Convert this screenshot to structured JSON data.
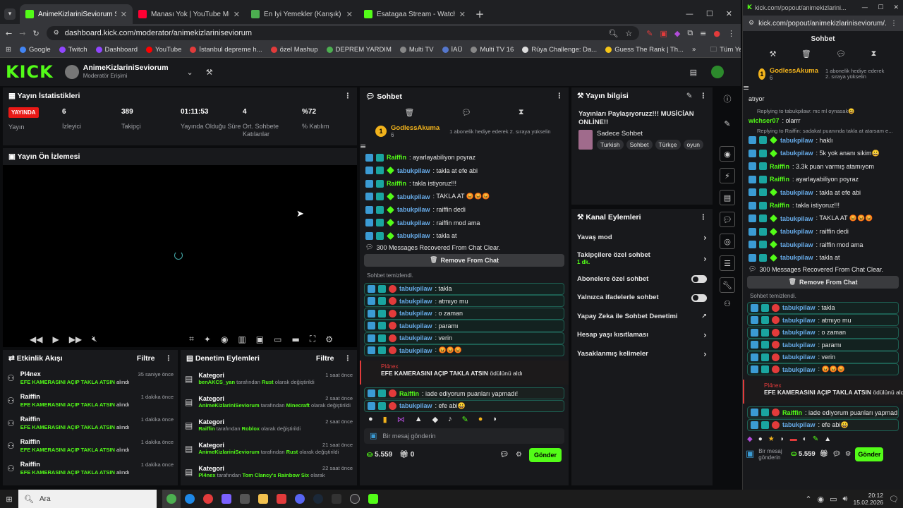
{
  "tabs": [
    {
      "title": "AnimeKizlariniSeviorum Stream",
      "color": "#53fc18",
      "active": true
    },
    {
      "title": "Manası Yok | YouTube Music",
      "color": "#ff0033",
      "active": false
    },
    {
      "title": "En İyi Yemekler (Karışık) - Tier List",
      "color": "#4caf50",
      "active": false
    },
    {
      "title": "Esatagaa Stream - Watch Live on Kick",
      "color": "#53fc18",
      "active": false
    }
  ],
  "address": {
    "url": "dashboard.kick.com/moderator/animekizlariniseviorum"
  },
  "bookmarks": [
    {
      "label": "Google",
      "color": "#4285f4"
    },
    {
      "label": "Twitch",
      "color": "#9146ff"
    },
    {
      "label": "Dashboard",
      "color": "#9146ff"
    },
    {
      "label": "YouTube",
      "color": "#ff0000"
    },
    {
      "label": "İstanbul depreme h...",
      "color": "#e23b3b"
    },
    {
      "label": "özel Mashup",
      "color": "#e23b3b"
    },
    {
      "label": "DEPREM YARDIM",
      "color": "#4caf50"
    },
    {
      "label": "Multi TV",
      "color": "#888"
    },
    {
      "label": "İAÜ",
      "color": "#5577cc"
    },
    {
      "label": "Multi TV 16",
      "color": "#888"
    },
    {
      "label": "Rüya Challenge: Da...",
      "color": "#ddd"
    },
    {
      "label": "Guess The Rank | Th...",
      "color": "#f5c518"
    }
  ],
  "bookmarks_all": "Tüm Yer İşaretleri",
  "header": {
    "logo": "KICK",
    "channel": "AnimeKizlariniSeviorum",
    "role": "Moderatör Erişimi"
  },
  "stats": {
    "title": "Yayın İstatistikleri",
    "live": "YAYINDA",
    "live_label": "Yayın",
    "items": [
      {
        "value": "6",
        "label": "İzleyici"
      },
      {
        "value": "389",
        "label": "Takipçi"
      },
      {
        "value": "01:11:53",
        "label": "Yayında Olduğu Süre"
      },
      {
        "value": "4",
        "label": "Ort. Sohbete Katılanlar"
      },
      {
        "value": "%72",
        "label": "% Katılım"
      }
    ]
  },
  "preview": {
    "title": "Yayın Ön İzlemesi"
  },
  "activity": {
    "title": "Etkinlik Akışı",
    "filter": "Filtre",
    "items": [
      {
        "user": "Pl4nex",
        "action": "EFE KAMERASINI AÇIP TAKLA ATSIN",
        "suffix": "alındı",
        "time": "35 saniye önce"
      },
      {
        "user": "Raiffin",
        "action": "EFE KAMERASINI AÇIP TAKLA ATSIN",
        "suffix": "alındı",
        "time": "1 dakika önce"
      },
      {
        "user": "Raiffin",
        "action": "EFE KAMERASINI AÇIP TAKLA ATSIN",
        "suffix": "alındı",
        "time": "1 dakika önce"
      },
      {
        "user": "Raiffin",
        "action": "EFE KAMERASINI AÇIP TAKLA ATSIN",
        "suffix": "alındı",
        "time": "1 dakika önce"
      },
      {
        "user": "Raiffin",
        "action": "EFE KAMERASINI AÇIP TAKLA ATSIN",
        "suffix": "alındı",
        "time": "1 dakika önce"
      }
    ]
  },
  "audit": {
    "title": "Denetim Eylemleri",
    "filter": "Filtre",
    "items": [
      {
        "title": "Kategori",
        "user": "benAKCS_yan",
        "mid": "tarafından",
        "target": "Rust",
        "tail": "olarak değiştirildi",
        "time": "1 saat önce"
      },
      {
        "title": "Kategori",
        "user": "AnimeKizlariniSeviorum",
        "mid": "tarafından",
        "target": "Minecraft",
        "tail": "olarak değiştirildi",
        "time": "2 saat önce"
      },
      {
        "title": "Kategori",
        "user": "Raiffin",
        "mid": "tarafından",
        "target": "Roblox",
        "tail": "olarak değiştirildi",
        "time": "2 saat önce"
      },
      {
        "title": "Kategori",
        "user": "AnimeKizlariniSeviorum",
        "mid": "tarafından",
        "target": "Rust",
        "tail": "olarak değiştirildi",
        "time": "21 saat önce"
      },
      {
        "title": "Kategori",
        "user": "Pl4nex",
        "mid": "tarafından",
        "target": "Tom Clancy's Rainbow Six",
        "tail": "olarak",
        "time": "22 saat önce"
      }
    ]
  },
  "chat": {
    "title": "Sohbet",
    "pinned_user": "GodlessAkuma",
    "pinned_count": "6",
    "pinned_note": "1 abonelik hediye ederek 2. sıraya yükselin",
    "messages": [
      {
        "user": "Raiffin",
        "text": ": ayarlayabiliyon poyraz",
        "kind": "green"
      },
      {
        "user": "tabukpilaw",
        "text": ": takla at efe abi",
        "kind": "blue"
      },
      {
        "user": "Raiffin",
        "text": ": takla istiyoruz!!!",
        "kind": "green"
      },
      {
        "user": "tabukpilaw",
        "text": ": TAKLA AT 😡😡😡",
        "kind": "blue"
      },
      {
        "user": "tabukpilaw",
        "text": ": raiffin dedi",
        "kind": "blue"
      },
      {
        "user": "tabukpilaw",
        "text": ": raiffin mod ama",
        "kind": "blue"
      },
      {
        "user": "tabukpilaw",
        "text": ": takla at",
        "kind": "blue"
      }
    ],
    "recovered": "300 Messages Recovered From Chat Clear.",
    "remove_btn": "Remove From Chat",
    "cleared": "Sohbet temizlendi.",
    "boxed": [
      {
        "user": "tabukpilaw",
        "text": ": takla"
      },
      {
        "user": "tabukpilaw",
        "text": ": atmıyo mu"
      },
      {
        "user": "tabukpilaw",
        "text": ": o zaman"
      },
      {
        "user": "tabukpilaw",
        "text": ": paramı"
      },
      {
        "user": "tabukpilaw",
        "text": ": verin"
      },
      {
        "user": "tabukpilaw",
        "text": ": 😡😡😡"
      }
    ],
    "redeem_user": "Pl4nex",
    "redeem_text": "EFE KAMERASINI AÇIP TAKLA ATSIN",
    "redeem_suffix": "ödülünü aldı",
    "after": [
      {
        "user": "Raiffin",
        "text": ": iade ediyorum puanları yapmadı!",
        "kind": "green"
      },
      {
        "user": "tabukpilaw",
        "text": ": efe abi😀",
        "kind": "blue"
      }
    ],
    "placeholder": "Bir mesaj gönderin",
    "points": "5.559",
    "gifts": "0",
    "send": "Gönder"
  },
  "streaminfo": {
    "title": "Yayın bilgisi",
    "headline": "Yayınları Paylaşıyoruzz!!! MUSİCİAN ONLİNE!!",
    "category": "Sadece Sohbet",
    "tags": [
      "Turkish",
      "Sohbet",
      "Türkçe",
      "oyun"
    ]
  },
  "actions": {
    "title": "Kanal Eylemleri",
    "items": [
      {
        "label": "Yavaş mod",
        "type": "chevron"
      },
      {
        "label": "Takipçilere özel sohbet",
        "sub": "1 dk.",
        "type": "chevron"
      },
      {
        "label": "Abonelere özel sohbet",
        "type": "toggle"
      },
      {
        "label": "Yalnızca ifadelerle sohbet",
        "type": "toggle"
      },
      {
        "label": "Yapay Zeka ile Sohbet Denetimi",
        "type": "external"
      },
      {
        "label": "Hesap yaşı kısıtlaması",
        "type": "chevron"
      },
      {
        "label": "Yasaklanmış kelimeler",
        "type": "chevron"
      }
    ]
  },
  "popout": {
    "window_title": "kick.com/popout/animekizlarini...",
    "url": "kick.com/popout/animekizlariniseviorum/...",
    "title": "Sohbet",
    "pinned_user": "GodlessAkuma",
    "pinned_count": "6",
    "pinned_note": "1 abonelik hediye ederek 2. sıraya yükselin",
    "partial": "atıyor",
    "reply1": "Replying to tabukpilaw: mc ml oynasak😀",
    "line1_user": "wichser07",
    "line1_text": ": olarrr",
    "reply2": "Replying to Raiffin: sadakat puanında takla at atarsam e...",
    "messages": [
      {
        "user": "tabukpilaw",
        "text": ": haklı",
        "kind": "blue"
      },
      {
        "user": "tabukpilaw",
        "text": ": 5k yok ananı sikim😀",
        "kind": "blue"
      },
      {
        "user": "Raiffin",
        "text": ": 3.3k puan varmış atamıyom",
        "kind": "green"
      },
      {
        "user": "Raiffin",
        "text": ": ayarlayabiliyon poyraz",
        "kind": "green"
      },
      {
        "user": "tabukpilaw",
        "text": ": takla at efe abi",
        "kind": "blue"
      },
      {
        "user": "Raiffin",
        "text": ": takla istiyoruz!!!",
        "kind": "green"
      },
      {
        "user": "tabukpilaw",
        "text": ": TAKLA AT 😡😡😡",
        "kind": "blue"
      },
      {
        "user": "tabukpilaw",
        "text": ": raiffin dedi",
        "kind": "blue"
      },
      {
        "user": "tabukpilaw",
        "text": ": raiffin mod ama",
        "kind": "blue"
      },
      {
        "user": "tabukpilaw",
        "text": ": takla at",
        "kind": "blue"
      }
    ],
    "recovered": "300 Messages Recovered From Chat Clear.",
    "remove_btn": "Remove From Chat",
    "cleared": "Sohbet temizlendi.",
    "boxed": [
      {
        "user": "tabukpilaw",
        "text": ": takla"
      },
      {
        "user": "tabukpilaw",
        "text": ": atmıyo mu"
      },
      {
        "user": "tabukpilaw",
        "text": ": o zaman"
      },
      {
        "user": "tabukpilaw",
        "text": ": paramı"
      },
      {
        "user": "tabukpilaw",
        "text": ": verin"
      },
      {
        "user": "tabukpilaw",
        "text": ": 😡😡😡"
      }
    ],
    "redeem_user": "Pl4nex",
    "redeem_text": "EFE KAMERASINI AÇIP TAKLA ATSIN",
    "redeem_suffix": "ödülünü aldı",
    "after": [
      {
        "user": "Raiffin",
        "text": ": iade ediyorum puanları yapmadı!",
        "kind": "green"
      },
      {
        "user": "tabukpilaw",
        "text": ": efe abi😀",
        "kind": "blue"
      }
    ],
    "placeholder": "Bir mesaj gönderin",
    "points": "5.559",
    "send": "Gönder"
  },
  "taskbar": {
    "search": "Ara",
    "time": "20:12",
    "date": "15.02.2026"
  }
}
